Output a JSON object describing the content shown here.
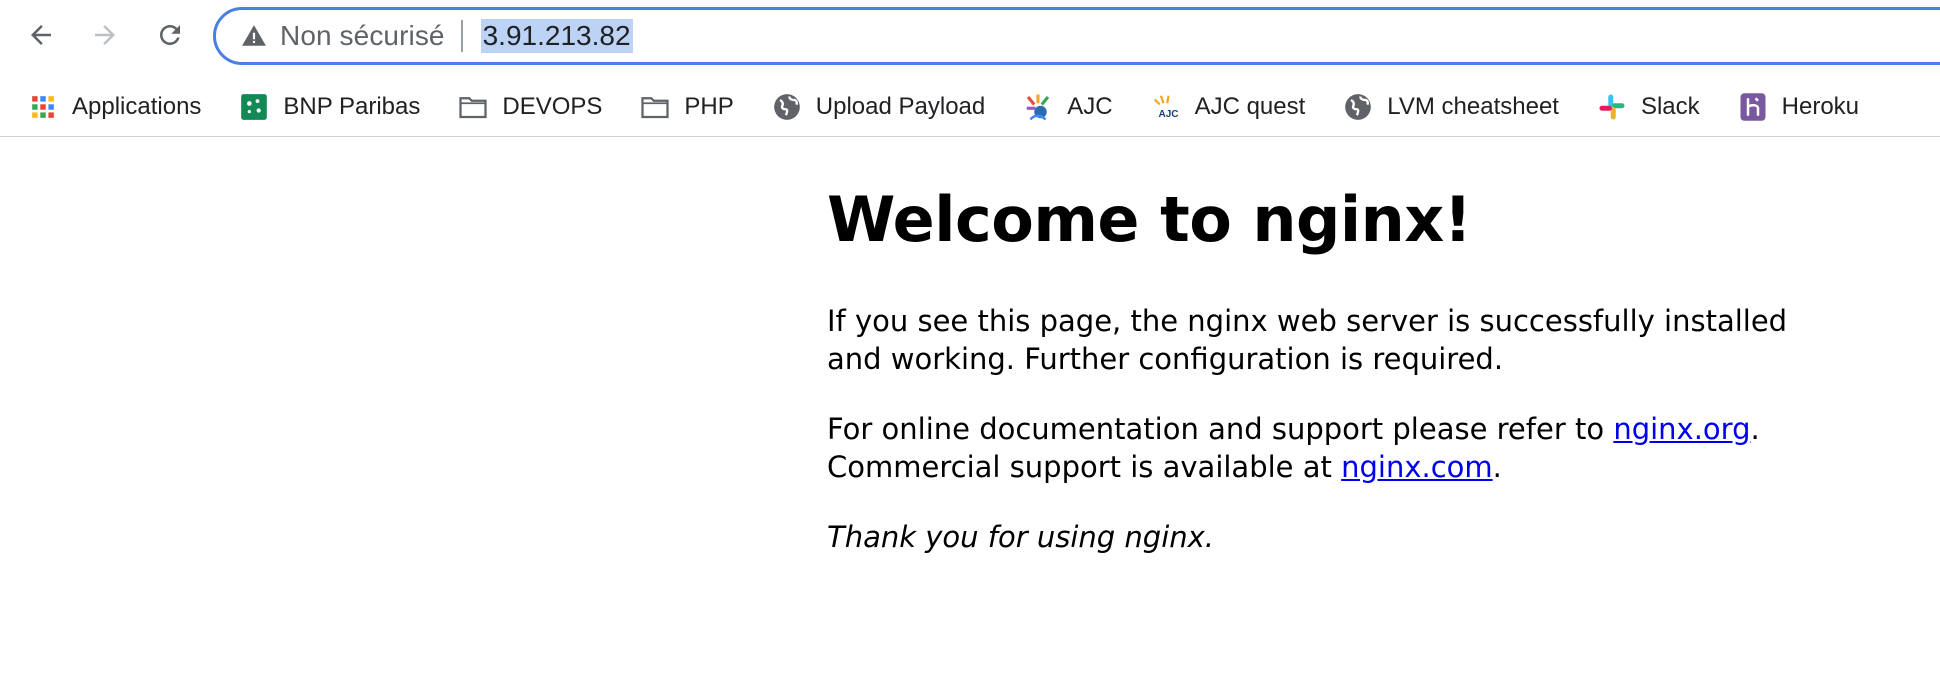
{
  "toolbar": {
    "security_label": "Non sécurisé",
    "url": "3.91.213.82"
  },
  "bookmarks": [
    {
      "label": "Applications",
      "icon": "apps-grid-icon"
    },
    {
      "label": "BNP Paribas",
      "icon": "bnp-paribas-icon"
    },
    {
      "label": "DEVOPS",
      "icon": "folder-icon"
    },
    {
      "label": "PHP",
      "icon": "folder-icon"
    },
    {
      "label": "Upload Payload",
      "icon": "globe-icon"
    },
    {
      "label": "AJC",
      "icon": "ajc-icon"
    },
    {
      "label": "AJC quest",
      "icon": "ajc-quest-icon"
    },
    {
      "label": "LVM cheatsheet",
      "icon": "globe-icon"
    },
    {
      "label": "Slack",
      "icon": "slack-icon"
    },
    {
      "label": "Heroku",
      "icon": "heroku-icon"
    }
  ],
  "page": {
    "heading": "Welcome to nginx!",
    "para1": "If you see this page, the nginx web server is successfully installed and working. Further configuration is required.",
    "para2_prefix": "For online documentation and support please refer to ",
    "link1": "nginx.org",
    "para2_mid": ".",
    "para2_line2": "Commercial support is available at ",
    "link2": "nginx.com",
    "para2_end": ".",
    "thanks": "Thank you for using nginx."
  },
  "colors": {
    "omnibox_border": "#4a80e0",
    "url_selection": "#bcd3f5",
    "link": "#0000ee"
  }
}
